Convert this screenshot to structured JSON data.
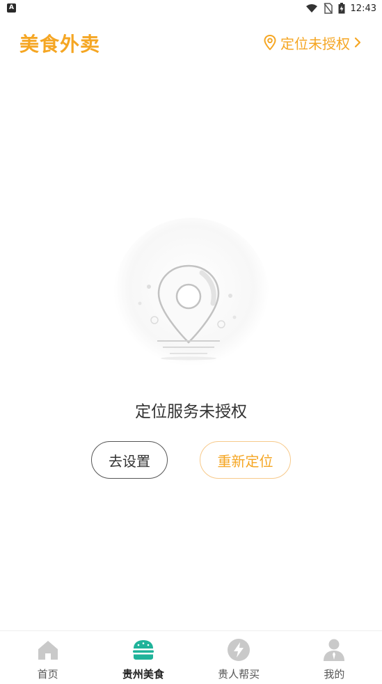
{
  "status_bar": {
    "notification_icon": "A",
    "time": "12:43"
  },
  "header": {
    "title": "美食外卖",
    "location_label": "定位未授权"
  },
  "empty_state": {
    "message": "定位服务未授权",
    "settings_button": "去设置",
    "relocate_button": "重新定位"
  },
  "tabbar": {
    "items": [
      {
        "label": "首页",
        "icon": "home-icon"
      },
      {
        "label": "贵州美食",
        "icon": "burger-icon",
        "active": true
      },
      {
        "label": "贵人帮买",
        "icon": "lightning-icon"
      },
      {
        "label": "我的",
        "icon": "user-icon"
      }
    ]
  },
  "colors": {
    "accent": "#f5a623",
    "active_tab": "#1fb39a",
    "inactive_icon": "#c9c9c9"
  }
}
